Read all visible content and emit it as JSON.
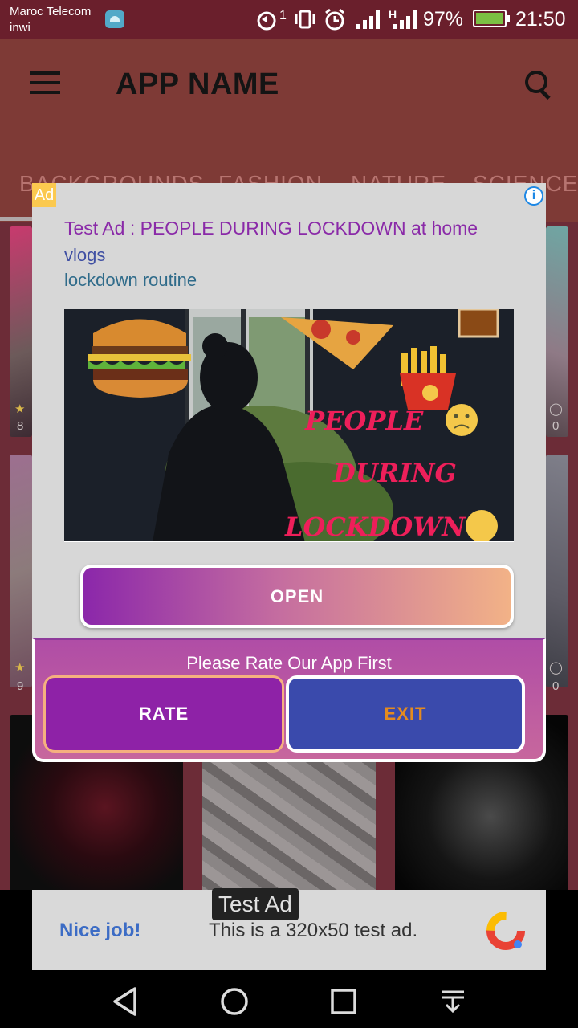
{
  "status_bar": {
    "carrier_1": "Maroc Telecom",
    "carrier_2": "inwi",
    "battery": "97%",
    "time": "21:50",
    "signal_2g": "H"
  },
  "app_bar": {
    "title": "APP NAME",
    "menu_icon": "menu-icon",
    "search_icon": "search-icon"
  },
  "tabs": [
    {
      "label": "BACKGROUNDS"
    },
    {
      "label": "FASHION"
    },
    {
      "label": "NATURE"
    },
    {
      "label": "SCIENCE"
    }
  ],
  "grid": {
    "row1": {
      "left_count": "8",
      "right_count": "0"
    },
    "row2": {
      "left_count": "9",
      "right_count": "0"
    }
  },
  "ad": {
    "badge": "Ad",
    "info_icon": "info-icon",
    "headline": "Test Ad : PEOPLE DURING LOCKDOWN at home",
    "line2": "vlogs",
    "line3": "lockdown routine",
    "image_text_1": "PEOPLE",
    "image_text_2": "DURING",
    "image_text_3": "LOCKDOWN",
    "cta": "OPEN"
  },
  "rate_dialog": {
    "prompt": "Please Rate Our App First",
    "rate_label": "RATE",
    "exit_label": "EXIT"
  },
  "banner": {
    "badge": "Test Ad",
    "nice": "Nice job!",
    "text": "This is a 320x50 test ad."
  },
  "colors": {
    "primary": "#8e22a7",
    "exit": "#3a4aac",
    "exit_text": "#e48b1f",
    "status_bar": "#6a1f2c"
  }
}
